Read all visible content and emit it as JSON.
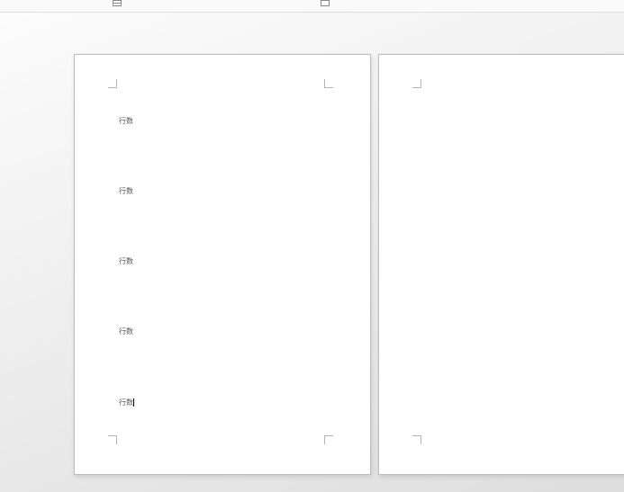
{
  "toolbar": {
    "icons": [
      "grid",
      "calendar"
    ]
  },
  "pages": [
    {
      "lines": [
        "行数",
        "行数",
        "行数",
        "行数",
        "行数"
      ],
      "cursor_on_last": true
    },
    {
      "lines": []
    }
  ]
}
